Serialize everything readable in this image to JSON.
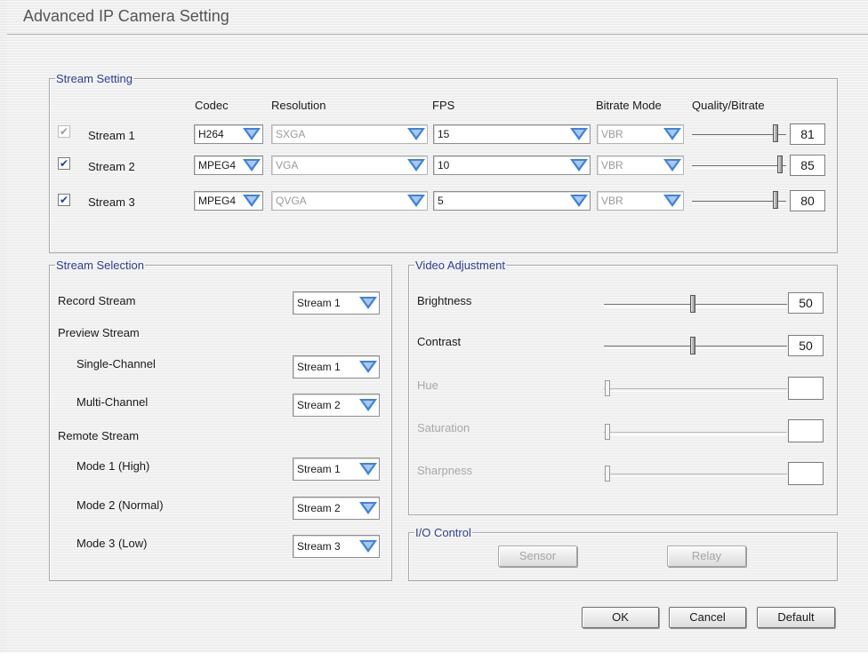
{
  "window": {
    "title": "Advanced IP Camera Setting"
  },
  "stream_setting": {
    "legend": "Stream Setting",
    "headers": {
      "codec": "Codec",
      "resolution": "Resolution",
      "fps": "FPS",
      "bitrate_mode": "Bitrate Mode",
      "quality": "Quality/Bitrate"
    },
    "rows": [
      {
        "name": "Stream 1",
        "checked": true,
        "checkbox_enabled": false,
        "codec": "H264",
        "resolution": "SXGA",
        "fps": "15",
        "bitrate_mode": "VBR",
        "quality": "81",
        "quality_level": 0.81
      },
      {
        "name": "Stream 2",
        "checked": true,
        "checkbox_enabled": true,
        "codec": "MPEG4",
        "resolution": "VGA",
        "fps": "10",
        "bitrate_mode": "VBR",
        "quality": "85",
        "quality_level": 0.85
      },
      {
        "name": "Stream 3",
        "checked": true,
        "checkbox_enabled": true,
        "codec": "MPEG4",
        "resolution": "QVGA",
        "fps": "5",
        "bitrate_mode": "VBR",
        "quality": "80",
        "quality_level": 0.8
      }
    ]
  },
  "stream_selection": {
    "legend": "Stream Selection",
    "record_stream": {
      "label": "Record Stream",
      "value": "Stream 1"
    },
    "preview_stream": {
      "label": "Preview Stream"
    },
    "single_channel": {
      "label": "Single-Channel",
      "value": "Stream 1"
    },
    "multi_channel": {
      "label": "Multi-Channel",
      "value": "Stream 2"
    },
    "remote_stream": {
      "label": "Remote Stream"
    },
    "mode1": {
      "label": "Mode 1 (High)",
      "value": "Stream 1"
    },
    "mode2": {
      "label": "Mode 2 (Normal)",
      "value": "Stream 2"
    },
    "mode3": {
      "label": "Mode 3 (Low)",
      "value": "Stream 3"
    }
  },
  "video_adjustment": {
    "legend": "Video Adjustment",
    "brightness": {
      "label": "Brightness",
      "value": "50",
      "level": 0.5,
      "enabled": true
    },
    "contrast": {
      "label": "Contrast",
      "value": "50",
      "level": 0.5,
      "enabled": true
    },
    "hue": {
      "label": "Hue",
      "value": "",
      "level": 0,
      "enabled": false
    },
    "saturation": {
      "label": "Saturation",
      "value": "",
      "level": 0,
      "enabled": false
    },
    "sharpness": {
      "label": "Sharpness",
      "value": "",
      "level": 0,
      "enabled": false
    }
  },
  "io_control": {
    "legend": "I/O Control",
    "sensor": "Sensor",
    "relay": "Relay"
  },
  "buttons": {
    "ok": "OK",
    "cancel": "Cancel",
    "default": "Default"
  },
  "colors": {
    "legend_text": "#2b3d9a",
    "dropdown_arrow": "#3d82e0"
  }
}
